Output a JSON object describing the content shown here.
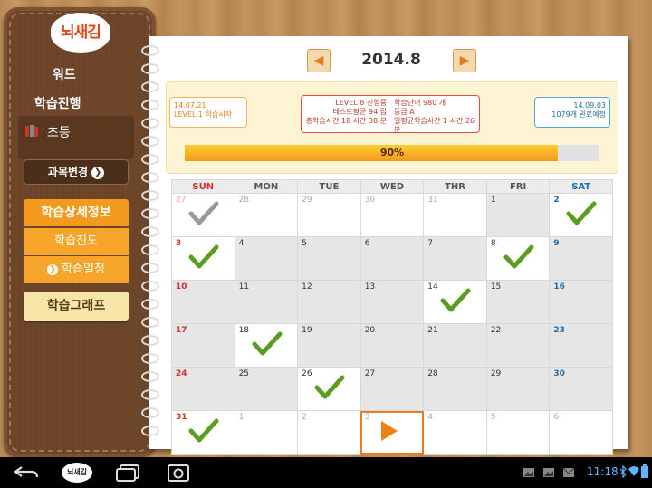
{
  "app": {
    "logo_text": "뇌새김",
    "logo_sub": "워드"
  },
  "sidebar": {
    "progress_label": "학습진행",
    "level_label": "초등",
    "change_button": "과목변경",
    "menu": {
      "detail": "학습상세정보",
      "progress": "학습진도",
      "schedule": "학습일정",
      "graph": "학습그래프"
    }
  },
  "header": {
    "month": "2014.8",
    "prev": "◀",
    "next": "▶"
  },
  "progress": {
    "start_date": "14.07.21",
    "start_text": "LEVEL 1 학습시작",
    "mid_left": [
      "LEVEL 8 진행중",
      "테스트평균 94 점",
      "총학습시간 18 시간 38 분"
    ],
    "mid_right": [
      "학습단어 980 개",
      "등급 A",
      "일평균학습시간 1 시간 26",
      "분"
    ],
    "end_date": "14.09.03",
    "end_text": "1079개 완료예정",
    "percent": 90,
    "percent_text": "90%"
  },
  "calendar": {
    "weekdays": [
      "SUN",
      "MON",
      "TUE",
      "WED",
      "THR",
      "FRI",
      "SAT"
    ],
    "weeks": [
      [
        {
          "d": "27",
          "out": true,
          "check": "gray"
        },
        {
          "d": "28",
          "out": true
        },
        {
          "d": "29",
          "out": true
        },
        {
          "d": "30",
          "out": true
        },
        {
          "d": "31",
          "out": true
        },
        {
          "d": "1"
        },
        {
          "d": "2",
          "check": "green"
        }
      ],
      [
        {
          "d": "3",
          "check": "green"
        },
        {
          "d": "4"
        },
        {
          "d": "5"
        },
        {
          "d": "6"
        },
        {
          "d": "7"
        },
        {
          "d": "8",
          "check": "green"
        },
        {
          "d": "9"
        }
      ],
      [
        {
          "d": "10"
        },
        {
          "d": "11"
        },
        {
          "d": "12"
        },
        {
          "d": "13"
        },
        {
          "d": "14",
          "check": "green"
        },
        {
          "d": "15"
        },
        {
          "d": "16"
        }
      ],
      [
        {
          "d": "17"
        },
        {
          "d": "18",
          "check": "green"
        },
        {
          "d": "19"
        },
        {
          "d": "20"
        },
        {
          "d": "21"
        },
        {
          "d": "22"
        },
        {
          "d": "23"
        }
      ],
      [
        {
          "d": "24"
        },
        {
          "d": "25"
        },
        {
          "d": "26",
          "check": "green"
        },
        {
          "d": "27"
        },
        {
          "d": "28"
        },
        {
          "d": "29"
        },
        {
          "d": "30"
        }
      ],
      [
        {
          "d": "31",
          "check": "green"
        },
        {
          "d": "1",
          "out": true
        },
        {
          "d": "2",
          "out": true
        },
        {
          "d": "3",
          "out": true,
          "today": true
        },
        {
          "d": "4",
          "out": true
        },
        {
          "d": "5",
          "out": true
        },
        {
          "d": "6",
          "out": true
        }
      ]
    ]
  },
  "systembar": {
    "time": "11:18",
    "icons": [
      "back-icon",
      "home-logo",
      "recent-apps-icon",
      "screenshot-icon",
      "gallery-icon",
      "bluetooth-icon",
      "wifi-icon",
      "battery-icon"
    ]
  },
  "colors": {
    "accent": "#f39a1e",
    "check_green": "#5a9e1f",
    "check_gray": "#999999",
    "today_border": "#e87c1e"
  }
}
